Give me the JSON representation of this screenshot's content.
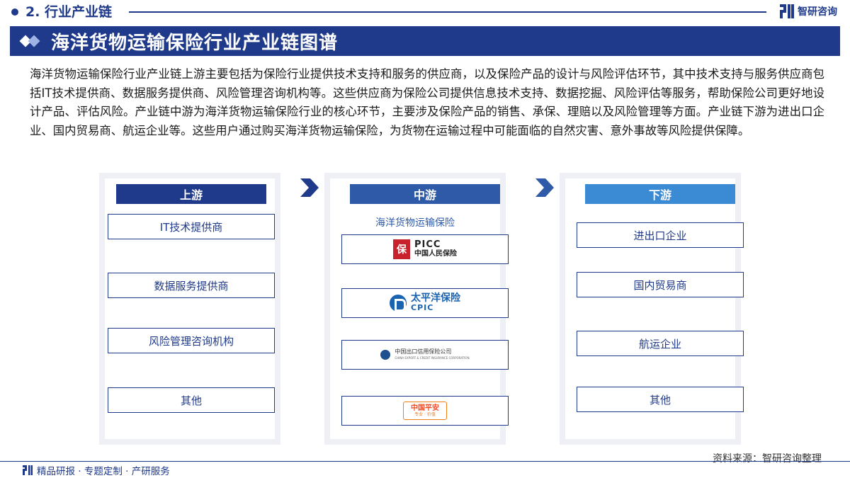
{
  "header": {
    "section": "2. 行业产业链",
    "brand": "智研咨询"
  },
  "banner": {
    "title": "海洋货物运输保险行业产业链图谱"
  },
  "intro": "海洋货物运输保险行业产业链上游主要包括为保险行业提供技术支持和服务的供应商，以及保险产品的设计与风险评估环节，其中技术支持与服务供应商包括IT技术提供商、数据服务提供商、风险管理咨询机构等。这些供应商为保险公司提供信息技术支持、数据挖掘、风险评估等服务，帮助保险公司更好地设计产品、评估风险。产业链中游为海洋货物运输保险行业的核心环节，主要涉及保险产品的销售、承保、理赔以及风险管理等方面。产业链下游为进出口企业、国内贸易商、航运企业等。这些用户通过购买海洋货物运输保险，为货物在运输过程中可能面临的自然灾害、意外事故等风险提供保障。",
  "upstream": {
    "title": "上游",
    "items": [
      "IT技术提供商",
      "数据服务提供商",
      "风险管理咨询机构",
      "其他"
    ]
  },
  "midstream": {
    "title": "中游",
    "caption": "海洋货物运输保险",
    "logos": {
      "picc_mark": "保",
      "picc_en": "PICC",
      "picc_cn": "中国人民保险",
      "cpic_cn": "太平洋保险",
      "cpic_en": "CPIC",
      "sinosure_cn": "中国出口信用保险公司",
      "sinosure_en": "CHINA EXPORT & CREDIT INSURANCE CORPORATION",
      "pingan_cn": "中国平安",
      "pingan_slogan": "专业 · 价值"
    }
  },
  "downstream": {
    "title": "下游",
    "items": [
      "进出口企业",
      "国内贸易商",
      "航运企业",
      "其他"
    ]
  },
  "footer": {
    "source": "资料来源：智研咨询整理",
    "tagline": "精品研报 · 专题定制 · 产研服务"
  },
  "colors": {
    "primary": "#1f3a8a",
    "mid": "#2e5aa8",
    "light": "#3a8ad4",
    "panel_bg": "#eef0f6"
  }
}
